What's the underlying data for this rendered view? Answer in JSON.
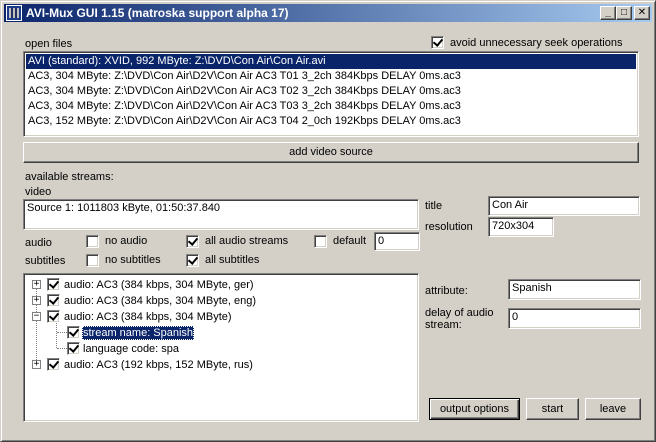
{
  "window": {
    "title": "AVI-Mux GUI 1.15 (matroska support alpha 17)",
    "minimize_glyph": "_",
    "maximize_glyph": "□",
    "close_glyph": "✕"
  },
  "open_files": {
    "label": "open files",
    "avoid_seek_label": "avoid unnecessary seek operations",
    "avoid_seek_checked": true,
    "items": [
      "AVI (standard): XVID, 992 MByte: Z:\\DVD\\Con Air\\Con Air.avi",
      "AC3, 304 MByte: Z:\\DVD\\Con Air\\D2V\\Con Air AC3 T01 3_2ch 384Kbps DELAY 0ms.ac3",
      "AC3, 304 MByte: Z:\\DVD\\Con Air\\D2V\\Con Air AC3 T02 3_2ch 384Kbps DELAY 0ms.ac3",
      "AC3, 304 MByte: Z:\\DVD\\Con Air\\D2V\\Con Air AC3 T03 3_2ch 384Kbps DELAY 0ms.ac3",
      "AC3, 152 MByte: Z:\\DVD\\Con Air\\D2V\\Con Air AC3 T04 2_0ch 192Kbps DELAY 0ms.ac3"
    ],
    "selected_index": 0,
    "add_video_source_label": "add video source"
  },
  "streams": {
    "available_label": "available streams:",
    "video_label": "video",
    "video_source": "Source 1: 1011803 kByte, 01:50:37.840",
    "title_label": "title",
    "title_value": "Con Air",
    "resolution_label": "resolution",
    "resolution_value": "720x304",
    "audio_label": "audio",
    "no_audio_label": "no audio",
    "no_audio_checked": false,
    "all_audio_label": "all audio streams",
    "all_audio_checked": true,
    "default_label": "default",
    "default_checked": false,
    "default_value": "0",
    "subtitles_label": "subtitles",
    "no_subtitles_label": "no subtitles",
    "no_subtitles_checked": false,
    "all_subtitles_label": "all subtitles",
    "all_subtitles_checked": true
  },
  "tree": {
    "items": [
      {
        "label": "audio: AC3 (384 kbps, 304 MByte, ger)",
        "expander": "+",
        "checked": true
      },
      {
        "label": "audio: AC3 (384 kbps, 304 MByte, eng)",
        "expander": "+",
        "checked": true
      },
      {
        "label": "audio: AC3 (384 kbps, 304 MByte)",
        "expander": "−",
        "checked": true
      },
      {
        "label": "stream name: Spanish",
        "checked": true,
        "selected": true
      },
      {
        "label": "language code: spa",
        "checked": true
      },
      {
        "label": "audio: AC3 (192 kbps, 152 MByte, rus)",
        "expander": "+",
        "checked": true
      }
    ]
  },
  "attributes": {
    "attribute_label": "attribute:",
    "attribute_value": "Spanish",
    "delay_label_line1": "delay of audio",
    "delay_label_line2": "stream:",
    "delay_value": "0"
  },
  "buttons": {
    "output_options": "output options",
    "start": "start",
    "leave": "leave"
  },
  "colors": {
    "face": "#d4d0c8",
    "selection": "#0a246a",
    "title_gradient_start": "#0a246a",
    "title_gradient_end": "#a6caf0"
  }
}
